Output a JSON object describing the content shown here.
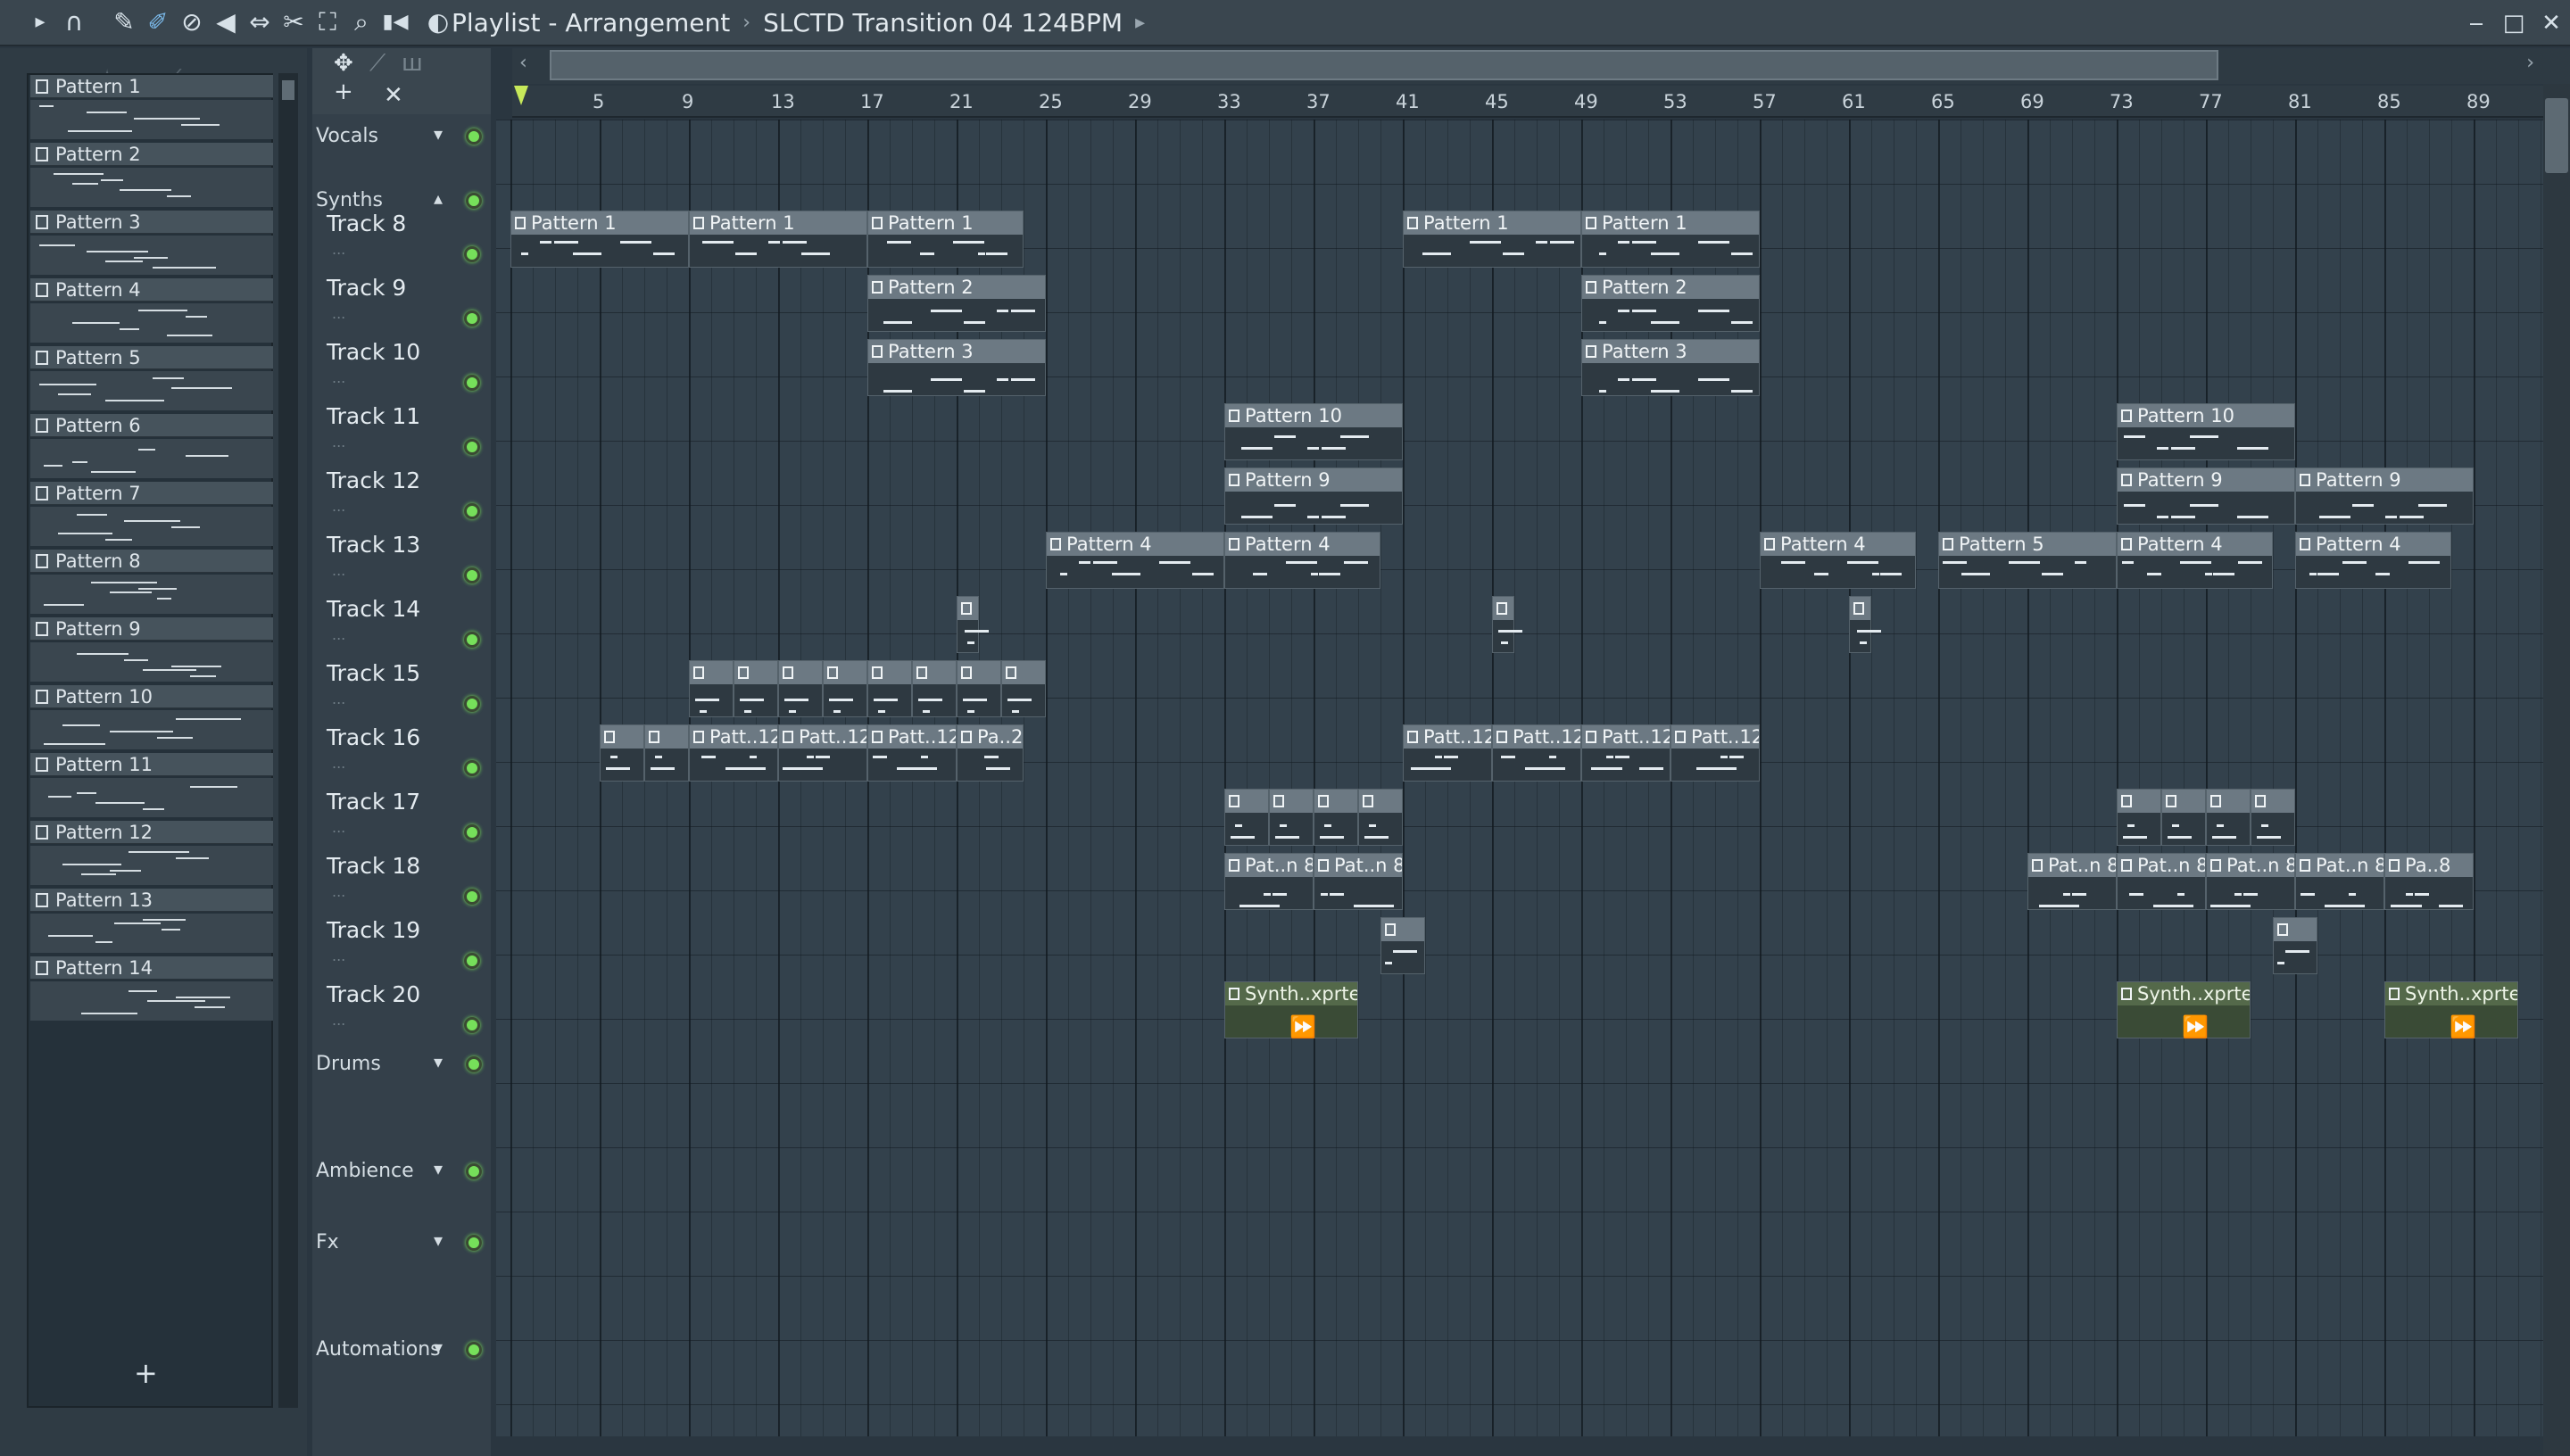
{
  "titlebar": {
    "title": "Playlist - Arrangement",
    "separator": "›",
    "arrangement": "SLCTD Transition 04 124BPM",
    "tool_icons": [
      "play-arrow-icon",
      "magnet-icon",
      "pencil-icon",
      "paint-brush-icon",
      "delete-icon",
      "mute-icon",
      "slip-icon",
      "slice-icon",
      "select-icon",
      "zoom-icon",
      "playback-icon"
    ],
    "tool_glyphs": [
      "▸",
      "∩",
      "✎",
      "✐",
      "⊘",
      "◀",
      "⇔",
      "✂",
      "⛶",
      "⌕",
      "▮◀"
    ],
    "window_buttons": {
      "minimize": "‒",
      "maximize": "□",
      "close": "✕"
    }
  },
  "picker": {
    "patterns": [
      "Pattern 1",
      "Pattern 2",
      "Pattern 3",
      "Pattern 4",
      "Pattern 5",
      "Pattern 6",
      "Pattern 7",
      "Pattern 8",
      "Pattern 9",
      "Pattern 10",
      "Pattern 11",
      "Pattern 12",
      "Pattern 13",
      "Pattern 14"
    ],
    "add_button": "+"
  },
  "header_tools": {
    "add": "+",
    "remove": "✕"
  },
  "ruler": {
    "bars": [
      "5",
      "9",
      "13",
      "17",
      "21",
      "25",
      "29",
      "33",
      "37",
      "41",
      "45",
      "49",
      "53",
      "57",
      "61",
      "65",
      "69",
      "73",
      "77",
      "81",
      "85",
      "89"
    ]
  },
  "groups": {
    "vocals": "Vocals",
    "synths": "Synths",
    "drums": "Drums",
    "ambience": "Ambience",
    "fx": "Fx",
    "automations": "Automations"
  },
  "tracks": [
    "Track 8",
    "Track 9",
    "Track 10",
    "Track 11",
    "Track 12",
    "Track 13",
    "Track 14",
    "Track 15",
    "Track 16",
    "Track 17",
    "Track 18",
    "Track 19",
    "Track 20"
  ],
  "clips": {
    "p1": "Pattern 1",
    "p2": "Pattern 2",
    "p3": "Pattern 3",
    "p4": "Pattern 4",
    "p5": "Pattern 5",
    "p9": "Pattern 9",
    "p10": "Pattern 10",
    "patt12": "Patt..12",
    "pa2": "Pa..2",
    "patn8": "Pat..n 8",
    "pa8": "Pa..8",
    "synth": "Synth..xprted"
  },
  "colors": {
    "accent_green": "#76e05a",
    "clip_header": "#6c7983",
    "audio_header": "#54694a",
    "note_pink": "#c46aa6",
    "note_olive": "#b0a55a",
    "note_lime": "#7ea64d",
    "note_purple": "#8a6bd0"
  }
}
